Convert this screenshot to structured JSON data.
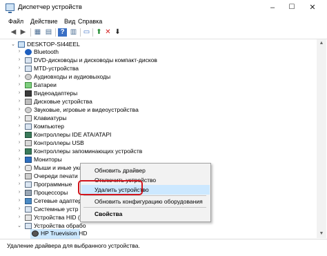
{
  "window": {
    "title": "Диспетчер устройств",
    "controls": [
      "–",
      "☐",
      "✕"
    ]
  },
  "menu": [
    "Файл",
    "Действие",
    "Вид",
    "Справка"
  ],
  "toolbar": [
    "◀",
    "▶",
    "▦",
    "▤",
    "?",
    "▥",
    "▭",
    "⬆",
    "✕",
    "⬇"
  ],
  "tree": {
    "root": "DESKTOP-SI44EEL",
    "items": [
      "Bluetooth",
      "DVD-дисководы и дисководы компакт-дисков",
      "MTD-устройства",
      "Аудиовходы и аудиовыходы",
      "Батареи",
      "Видеоадаптеры",
      "Дисковые устройства",
      "Звуковые, игровые и видеоустройства",
      "Клавиатуры",
      "Компьютер",
      "Контроллеры IDE ATA/ATAPI",
      "Контроллеры USB",
      "Контроллеры запоминающих устройств",
      "Мониторы",
      "Мыши и иные указывающие устройства",
      "Очереди печати",
      "Программные",
      "Процессоры",
      "Сетевые адаптеры",
      "Системные устр",
      "Устройства HID (",
      "Устройства обрабо"
    ],
    "child": "HP Truevision HD"
  },
  "context_menu": {
    "items": [
      "Обновить драйвер",
      "Отключить устройство",
      "Удалить устройство",
      "Обновить конфигурацию оборудования",
      "Свойства"
    ]
  },
  "status": "Удаление драйвера для выбранного устройства.",
  "colors": {
    "accent": "#cce8ff",
    "highlight_border": "#d2141c",
    "selection": "#cce8ff"
  }
}
